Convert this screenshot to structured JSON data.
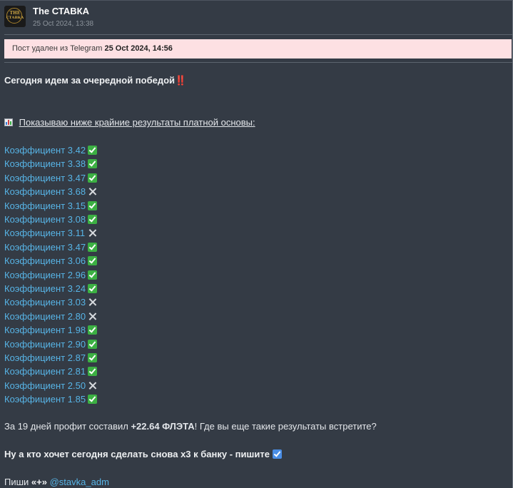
{
  "channel": {
    "name": "The СТАВКА",
    "date": "25 Oct 2024, 13:38",
    "avatar_line1": "THE",
    "avatar_line2": "СТАВКА"
  },
  "banner": {
    "prefix": "Пост удален из Telegram",
    "date": "25 Oct 2024, 14:56",
    "color": "#fde0e3"
  },
  "post": {
    "intro": "Сегодня идем за очередной победой‼️",
    "results_heading": "Показываю ниже крайние результаты платной основы:",
    "odds": [
      {
        "label": "Коэффициент 3.42",
        "result": "win"
      },
      {
        "label": "Коэффициент 3.38",
        "result": "win"
      },
      {
        "label": "Коэффициент 3.47",
        "result": "win"
      },
      {
        "label": "Коэффициент 3.68",
        "result": "loss"
      },
      {
        "label": "Коэффициент 3.15",
        "result": "win"
      },
      {
        "label": "Коэффициент 3.08",
        "result": "win"
      },
      {
        "label": "Коэффициент 3.11",
        "result": "loss"
      },
      {
        "label": "Коэффициент 3.47",
        "result": "win"
      },
      {
        "label": "Коэффициент 3.06",
        "result": "win"
      },
      {
        "label": "Коэффициент 2.96",
        "result": "win"
      },
      {
        "label": "Коэффициент 3.24",
        "result": "win"
      },
      {
        "label": "Коэффициент 3.03",
        "result": "loss"
      },
      {
        "label": "Коэффициент 2.80",
        "result": "loss"
      },
      {
        "label": "Коэффициент 1.98",
        "result": "win"
      },
      {
        "label": "Коэффициент 2.90",
        "result": "win"
      },
      {
        "label": "Коэффициент 2.87",
        "result": "win"
      },
      {
        "label": "Коэффициент 2.81",
        "result": "win"
      },
      {
        "label": "Коэффициент 2.50",
        "result": "loss"
      },
      {
        "label": "Коэффициент 1.85",
        "result": "win"
      }
    ],
    "summary_before": "За 19 дней профит составил ",
    "summary_value": "+22.64 ФЛЭТА",
    "summary_after": "! Где вы еще такие результаты встретите?",
    "cta": "Ну а кто хочет сегодня сделать снова х3 к банку - пишите",
    "contact_prefix": "Пиши ",
    "contact_quote": "«+»",
    "contact_mention": "@stavka_adm"
  },
  "icons": {
    "stats": "bar-chart-icon",
    "win": "green-check-icon",
    "loss": "cross-icon",
    "cta": "blue-check-icon"
  },
  "colors": {
    "background": "#343b45",
    "link": "#57b4e6",
    "win": "#3cb043",
    "cta_check": "#4a8ee6"
  }
}
